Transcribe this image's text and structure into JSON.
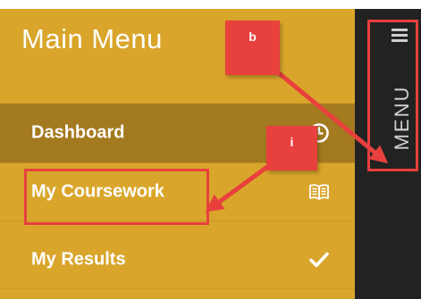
{
  "menu": {
    "title": "Main Menu",
    "items": [
      {
        "label": "Dashboard",
        "icon": "clock-icon",
        "active": true
      },
      {
        "label": "My Coursework",
        "icon": "book-icon",
        "active": false
      },
      {
        "label": "My Results",
        "icon": "checkmark-icon",
        "active": false
      }
    ]
  },
  "side_strip": {
    "toggle_label": "MENU",
    "icon": "hamburger-icon"
  },
  "annotations": {
    "callout_b": "b",
    "callout_i": "i"
  },
  "colors": {
    "menu_background": "#d9a52b",
    "active_item": "#a47a20",
    "strip_background": "#222222",
    "annotation_red": "#e8403d"
  }
}
